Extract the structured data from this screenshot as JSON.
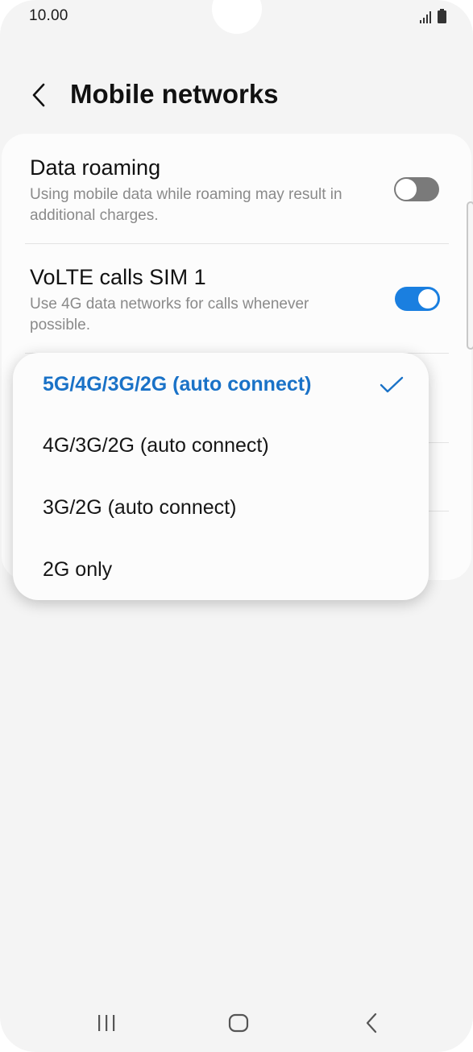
{
  "status_bar": {
    "time": "10.00",
    "icons": [
      "signal-icon",
      "battery-icon"
    ]
  },
  "header": {
    "title": "Mobile networks",
    "back_icon": "chevron-left-icon"
  },
  "settings": {
    "data_roaming": {
      "title": "Data roaming",
      "subtitle": "Using mobile data while roaming may result in additional charges.",
      "enabled": false
    },
    "volte": {
      "title": "VoLTE calls SIM 1",
      "subtitle": "Use 4G data networks for calls whenever possible.",
      "enabled": true
    }
  },
  "network_mode_popup": {
    "options": [
      {
        "label": "5G/4G/3G/2G (auto connect)",
        "selected": true
      },
      {
        "label": "4G/3G/2G (auto connect)",
        "selected": false
      },
      {
        "label": "3G/2G (auto connect)",
        "selected": false
      },
      {
        "label": "2G only",
        "selected": false
      }
    ],
    "selected_color": "#1a72c7"
  },
  "nav_bar": {
    "icons": [
      "recent-apps-icon",
      "home-icon",
      "back-icon"
    ]
  },
  "colors": {
    "accent": "#1a7fe0",
    "background": "#f4f4f4",
    "card": "#fcfcfc"
  }
}
